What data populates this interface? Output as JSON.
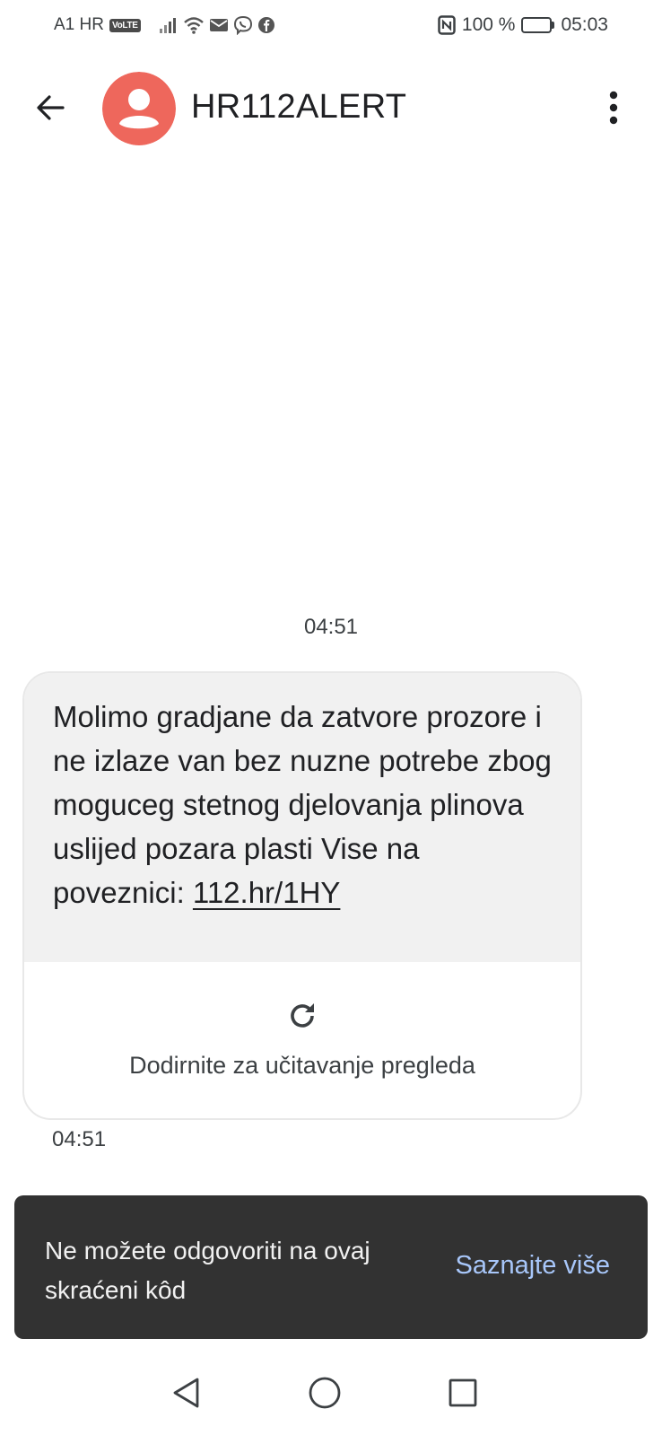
{
  "status_bar": {
    "carrier": "A1 HR",
    "network_badge": "VoLTE",
    "icons": [
      "signal-icon",
      "wifi-icon",
      "mail-icon",
      "viber-icon",
      "facebook-icon"
    ],
    "nfc_icon": "nfc-icon",
    "battery_percent": "100 %",
    "battery_level": 1.0,
    "time": "05:03"
  },
  "header": {
    "title": "HR112ALERT",
    "avatar_color": "#ee675c",
    "back_icon": "arrow-left-icon",
    "menu_icon": "more-vert-icon"
  },
  "conversation": {
    "date_stamp": "04:51",
    "message": {
      "text": "Molimo gradjane da zatvore prozore i ne izlaze van bez nuzne potrebe zbog moguceg stetnog djelovanja plinova uslijed pozara plasti Vise na poveznici: ",
      "link": "112.hr/1HY",
      "preview_label": "Dodirnite za učitavanje pregleda",
      "time": "04:51"
    }
  },
  "snackbar": {
    "message": "Ne možete odgovoriti na ovaj skraćeni kôd",
    "action": "Saznajte više",
    "action_color": "#a8c7fa"
  },
  "nav_bar": {
    "icons": [
      "back-triangle-icon",
      "home-circle-icon",
      "recents-square-icon"
    ]
  }
}
